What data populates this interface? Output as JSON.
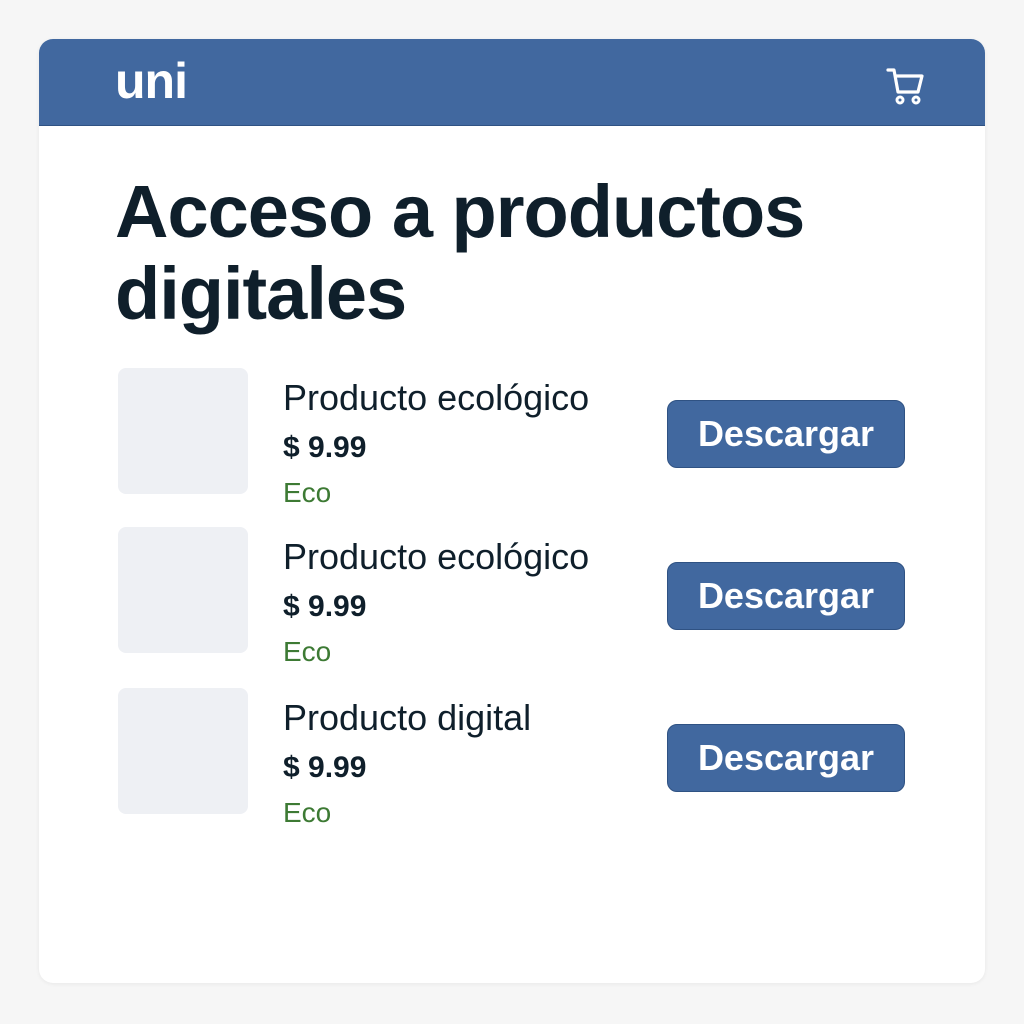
{
  "header": {
    "brand": "uni",
    "cart_icon": "cart-icon"
  },
  "page": {
    "title": "Acceso a productos digitales"
  },
  "products": [
    {
      "name": "Producto ecológico",
      "price": "$ 9.99",
      "tag": "Eco",
      "button_label": "Descargar"
    },
    {
      "name": "Producto ecológico",
      "price": "$ 9.99",
      "tag": "Eco",
      "button_label": "Descargar"
    },
    {
      "name": "Producto digital",
      "price": "$ 9.99",
      "tag": "Eco",
      "button_label": "Descargar"
    }
  ],
  "colors": {
    "primary": "#41689f",
    "title": "#0f1f2b",
    "eco": "#3d7a34",
    "thumbnail": "#eef0f4"
  }
}
